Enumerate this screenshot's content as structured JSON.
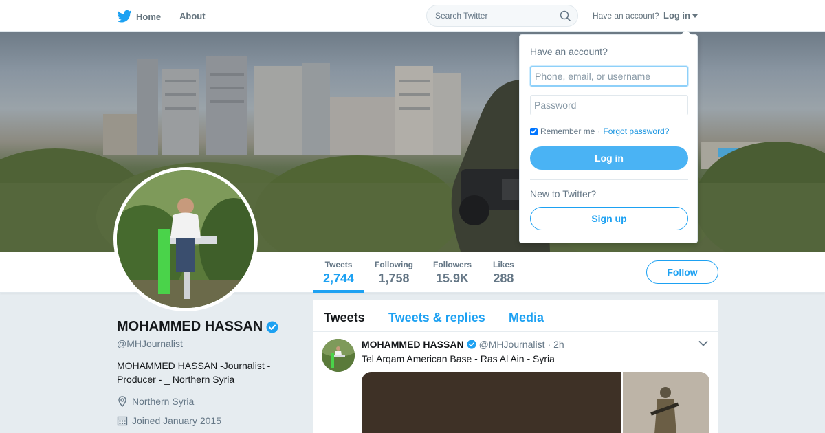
{
  "nav": {
    "home_label": "Home",
    "about_label": "About",
    "search_placeholder": "Search Twitter",
    "have_account": "Have an account?",
    "login_label": "Log in"
  },
  "profile": {
    "name": "MOHAMMED HASSAN",
    "handle": "@MHJournalist",
    "bio": "MOHAMMED HASSAN -Journalist - Producer - _ Northern Syria",
    "location": "Northern Syria",
    "joined": "Joined January 2015"
  },
  "stats": [
    {
      "label": "Tweets",
      "value": "2,744"
    },
    {
      "label": "Following",
      "value": "1,758"
    },
    {
      "label": "Followers",
      "value": "15.9K"
    },
    {
      "label": "Likes",
      "value": "288"
    }
  ],
  "follow_label": "Follow",
  "timeline": {
    "tabs": [
      "Tweets",
      "Tweets & replies",
      "Media"
    ],
    "tweet": {
      "name": "MOHAMMED HASSAN",
      "handle": "@MHJournalist",
      "separator": "·",
      "time": "2h",
      "text": "Tel Arqam American Base - Ras Al Ain - Syria"
    }
  },
  "login_dropdown": {
    "title": "Have an account?",
    "username_placeholder": "Phone, email, or username",
    "password_placeholder": "Password",
    "remember_label": "Remember me",
    "separator": "·",
    "forgot_label": "Forgot password?",
    "login_button": "Log in",
    "new_label": "New to Twitter?",
    "signup_button": "Sign up"
  },
  "colors": {
    "accent": "#1da1f2",
    "login_button": "#4ab3f4",
    "background": "#e6ecf0"
  },
  "icons": [
    "twitter-bird-icon",
    "search-icon",
    "chevron-down-icon",
    "verified-badge-icon",
    "location-pin-icon",
    "calendar-icon"
  ]
}
